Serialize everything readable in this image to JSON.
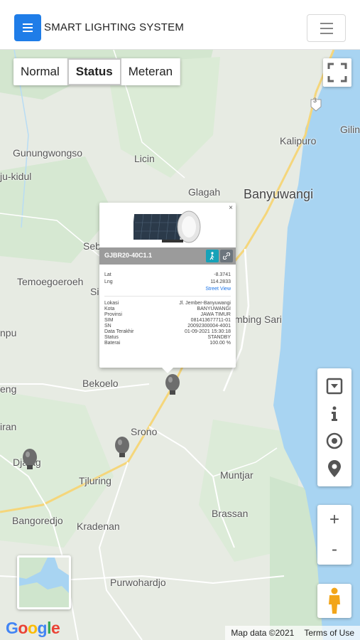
{
  "header": {
    "title": "SMART LIGHTING SYSTEM",
    "menu_icon": "hamburger-icon",
    "nav_toggle_icon": "hamburger-icon"
  },
  "map_mode_tabs": [
    {
      "label": "Normal",
      "active": false
    },
    {
      "label": "Status",
      "active": true
    },
    {
      "label": "Meteran",
      "active": false
    }
  ],
  "places": {
    "gunungwongso": "Gunungwongso",
    "licin": "Licin",
    "jukidul": "ju-kidul",
    "glagah": "Glagah",
    "banyuwangi": "Banyuwangi",
    "kalipuro": "Kalipuro",
    "gilin": "Gilin",
    "seb": "Seb",
    "temoegoeroeh": "Temoegoeroeh",
    "si": "Si",
    "npu": "npu",
    "mbingsari": "mbing Sari",
    "eng": "eng",
    "bekoelo": "Bekoelo",
    "iran": "iran",
    "srono": "Srono",
    "djajag": "Djajag",
    "tjluring": "Tjluring",
    "muntjar": "Muntjar",
    "bangoredjo": "Bangoredjo",
    "kradenan": "Kradenan",
    "brassan": "Brassan",
    "purwohardjo": "Purwohardjo",
    "route_shield": "3"
  },
  "popup": {
    "close": "×",
    "device_id": "GJBR20-40C1.1",
    "coords": [
      {
        "label": "Lat",
        "value": "-8.3741"
      },
      {
        "label": "Lng",
        "value": "114.2833"
      }
    ],
    "street_view": "Street View",
    "details": [
      {
        "label": "Lokasi",
        "value": "Jl. Jember-Banyuwangi"
      },
      {
        "label": "Kota",
        "value": "BANYUWANGI"
      },
      {
        "label": "Provinsi",
        "value": "JAWA TIMUR"
      },
      {
        "label": "SIM",
        "value": "081413677711-01"
      },
      {
        "label": "SN",
        "value": "20092300004-4001"
      },
      {
        "label": "Data Terakhir",
        "value": "01-09-2021 15:30:18"
      },
      {
        "label": "Status",
        "value": "STANDBY"
      },
      {
        "label": "Baterai",
        "value": "100.00 %"
      }
    ]
  },
  "controls": {
    "zoom_in": "+",
    "zoom_out": "-"
  },
  "footer": {
    "google": [
      "G",
      "o",
      "o",
      "g",
      "l",
      "e"
    ],
    "map_data": "Map data ©2021",
    "terms": "Terms of Use"
  },
  "colors": {
    "brand": "#1f7de8",
    "water": "#a8d4f2",
    "land": "#e7ebe3",
    "forest": "#cfe5cd",
    "road_major": "#f5d67b"
  }
}
